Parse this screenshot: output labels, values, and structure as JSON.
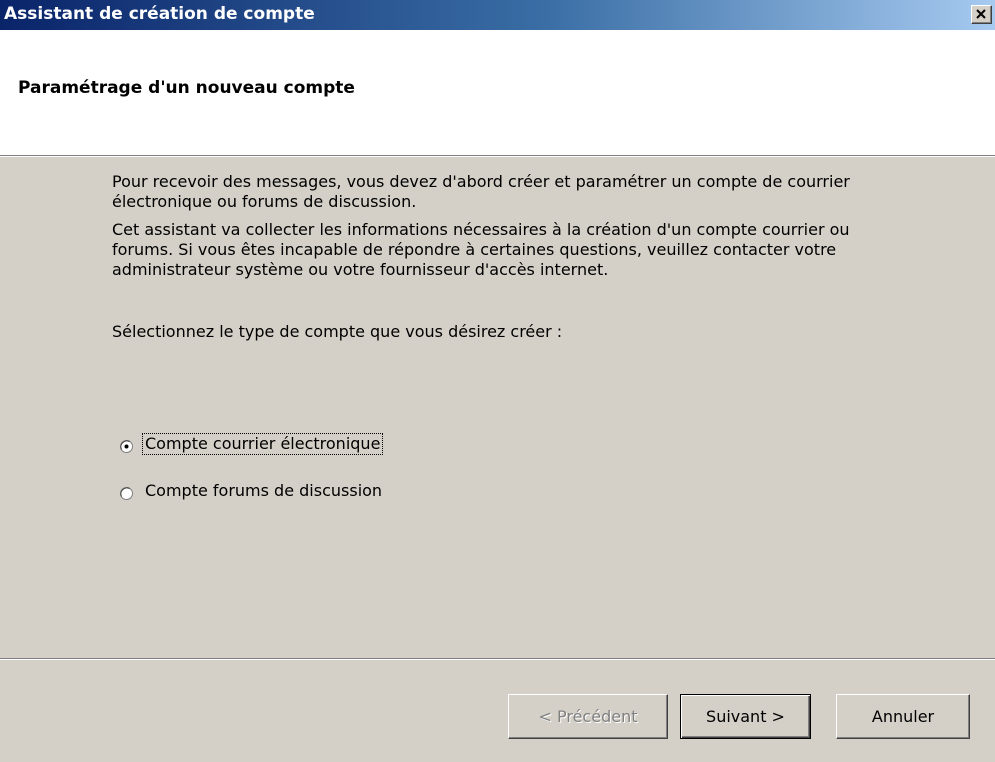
{
  "window": {
    "title": "Assistant de création de compte",
    "close_label": "×"
  },
  "header": {
    "title": "Paramétrage d'un nouveau compte"
  },
  "body": {
    "paragraphs": [
      "Pour recevoir des messages, vous devez d'abord créer et paramétrer un compte de courrier électronique ou forums de discussion.",
      "Cet assistant va collecter les informations nécessaires à la création d'un compte courrier ou forums. Si vous êtes incapable de répondre à certaines questions, veuillez contacter votre administrateur système ou votre fournisseur d'accès internet.",
      "Sélectionnez le type de compte que vous désirez créer :"
    ],
    "options": [
      {
        "label": "Compte courrier électronique",
        "selected": true
      },
      {
        "label": "Compte forums de discussion",
        "selected": false
      }
    ]
  },
  "buttons": {
    "previous": {
      "label": "< Précédent",
      "enabled": false
    },
    "next": {
      "label": "Suivant >",
      "enabled": true
    },
    "cancel": {
      "label": "Annuler",
      "enabled": true
    }
  },
  "colors": {
    "titlebar_start": "#0a246a",
    "titlebar_end": "#a6caf0",
    "face": "#d4d0c8",
    "header_bg": "#ffffff"
  }
}
